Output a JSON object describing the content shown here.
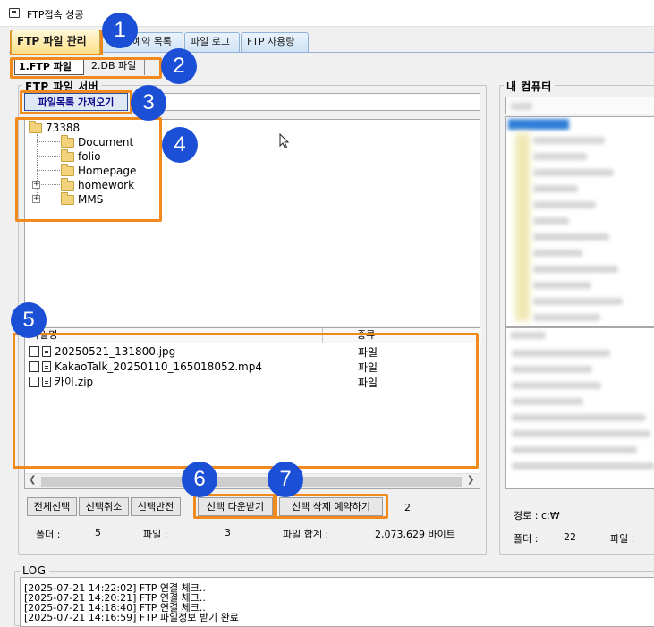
{
  "window": {
    "title": "FTP접속 성공"
  },
  "tabs": [
    {
      "label": "FTP 파일 관리"
    },
    {
      "label": "예약 목록"
    },
    {
      "label": "파일 로그"
    },
    {
      "label": "FTP 사용량"
    }
  ],
  "subtabs": [
    {
      "label": "1.FTP 파일"
    },
    {
      "label": "2.DB 파일"
    }
  ],
  "ftp_server": {
    "group_label": "FTP 파일 서버",
    "fetch_button": "파일목록 가져오기",
    "path_value": "/",
    "tree": {
      "root": "73388",
      "children": [
        {
          "label": "Document"
        },
        {
          "label": "folio"
        },
        {
          "label": "Homepage"
        },
        {
          "label": "homework"
        },
        {
          "label": "MMS"
        }
      ]
    },
    "file_table": {
      "columns": [
        "파일명",
        "종류"
      ],
      "rows": [
        {
          "name": "20250521_131800.jpg",
          "type": "파일"
        },
        {
          "name": "KakaoTalk_20250110_165018052.mp4",
          "type": "파일"
        },
        {
          "name": "카이.zip",
          "type": "파일"
        }
      ]
    },
    "buttons": {
      "select_all": "전체선택",
      "deselect": "선택취소",
      "invert": "선택반전",
      "download": "선택 다운받기",
      "reserve_delete": "선택 삭제 예약하기"
    },
    "selected_count": "2",
    "stats": {
      "folder_label": "폴더 :",
      "folder_count": "5",
      "file_label": "파일 :",
      "file_count": "3",
      "total_label": "파일 합계 :",
      "total_value": "2,073,629 바이트"
    }
  },
  "my_computer": {
    "group_label": "내 컴퓨터",
    "path_text": "경로 : c:₩",
    "folder_label": "폴더 :",
    "folder_count": "22",
    "file_label": "파일 :"
  },
  "log": {
    "label": "LOG",
    "lines": [
      "[2025-07-21 14:22:02] FTP 연결 체크..",
      "[2025-07-21 14:20:21] FTP 연결 체크..",
      "[2025-07-21 14:18:40] FTP 연결 체크..",
      "[2025-07-21 14:16:59] FTP 파일정보 받기 완료"
    ]
  },
  "annotations": [
    "1",
    "2",
    "3",
    "4",
    "5",
    "6",
    "7"
  ]
}
